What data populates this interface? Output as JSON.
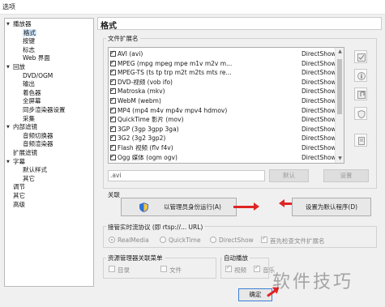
{
  "window": {
    "title": "选项"
  },
  "tree": [
    {
      "label": "播放器",
      "depth": 0,
      "exp": "▼"
    },
    {
      "label": "格式",
      "depth": 1,
      "selected": true
    },
    {
      "label": "按键",
      "depth": 1
    },
    {
      "label": "标志",
      "depth": 1
    },
    {
      "label": "Web 界面",
      "depth": 1
    },
    {
      "label": "回放",
      "depth": 0,
      "exp": "▼"
    },
    {
      "label": "DVD/OGM",
      "depth": 1
    },
    {
      "label": "输出",
      "depth": 1
    },
    {
      "label": "着色器",
      "depth": 1
    },
    {
      "label": "全屏幕",
      "depth": 1
    },
    {
      "label": "同步渲染器设置",
      "depth": 1
    },
    {
      "label": "采集",
      "depth": 1
    },
    {
      "label": "内部滤镜",
      "depth": 0,
      "exp": "▼"
    },
    {
      "label": "音频切换器",
      "depth": 1
    },
    {
      "label": "音频渲染器",
      "depth": 1
    },
    {
      "label": "扩展滤镜",
      "depth": 0
    },
    {
      "label": "字幕",
      "depth": 0,
      "exp": "▼"
    },
    {
      "label": "默认样式",
      "depth": 1
    },
    {
      "label": "其它",
      "depth": 1
    },
    {
      "label": "调节",
      "depth": 0
    },
    {
      "label": "其它",
      "depth": 0
    },
    {
      "label": "高级",
      "depth": 0
    }
  ],
  "header": {
    "title": "格式"
  },
  "ext_group": {
    "title": "文件扩展名"
  },
  "formats": [
    {
      "name": "AVI (avi)",
      "source": "DirectShow"
    },
    {
      "name": "MPEG (mpg mpeg mpe m1v m2v m...",
      "source": "DirectShow"
    },
    {
      "name": "MPEG-TS (ts tp trp m2t m2ts mts re...",
      "source": "DirectShow"
    },
    {
      "name": "DVD-视频 (vob ifo)",
      "source": "DirectShow"
    },
    {
      "name": "Matroska (mkv)",
      "source": "DirectShow"
    },
    {
      "name": "WebM (webm)",
      "source": "DirectShow"
    },
    {
      "name": "MP4 (mp4 m4v mp4v mpv4 hdmov)",
      "source": "DirectShow"
    },
    {
      "name": "QuickTime 影片 (mov)",
      "source": "DirectShow"
    },
    {
      "name": "3GP (3gp 3gpp 3ga)",
      "source": "DirectShow"
    },
    {
      "name": "3G2 (3g2 3gp2)",
      "source": "DirectShow"
    },
    {
      "name": "Flash 视频 (flv f4v)",
      "source": "DirectShow"
    },
    {
      "name": "Ogg 媒体 (ogm ogv)",
      "source": "DirectShow"
    }
  ],
  "ext_field": {
    "value": ".avi"
  },
  "buttons": {
    "default": "默认",
    "settings": "设置",
    "run_admin": "以管理员身份运行(A)",
    "set_default": "设置为默认程序(D)",
    "ok": "确定"
  },
  "assoc_group": {
    "title": "关联"
  },
  "realtime": {
    "label": "接管实时流协议 (即 rtsp://... URL)",
    "options": [
      "RealMedia",
      "QuickTime",
      "DirectShow"
    ],
    "check_ext": "首先检查文件扩展名"
  },
  "explorer": {
    "title": "资源管理器关联菜单",
    "dir": "目录",
    "file": "文件"
  },
  "autoplay": {
    "title": "自动播放",
    "video": "视频",
    "music": "音乐"
  },
  "watermark": "软件技巧"
}
